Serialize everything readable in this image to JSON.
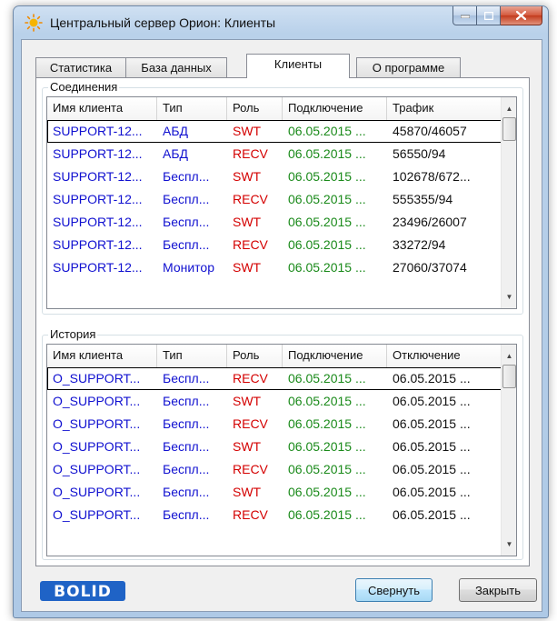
{
  "window": {
    "title": "Центральный сервер Орион: Клиенты"
  },
  "tabs": [
    {
      "label": "Статистика",
      "active": false
    },
    {
      "label": "База данных",
      "active": false
    },
    {
      "label": "Клиенты",
      "active": true
    },
    {
      "label": "О программе",
      "active": false
    }
  ],
  "connections": {
    "group_label": "Соединения",
    "columns": [
      "Имя клиента",
      "Тип",
      "Роль",
      "Подключение",
      "Трафик"
    ],
    "rows": [
      [
        "SUPPORT-12...",
        "АБД",
        "SWT",
        "06.05.2015 ...",
        "45870/46057"
      ],
      [
        "SUPPORT-12...",
        "АБД",
        "RECV",
        "06.05.2015 ...",
        "56550/94"
      ],
      [
        "SUPPORT-12...",
        "Беспл...",
        "SWT",
        "06.05.2015 ...",
        "102678/672..."
      ],
      [
        "SUPPORT-12...",
        "Беспл...",
        "RECV",
        "06.05.2015 ...",
        "555355/94"
      ],
      [
        "SUPPORT-12...",
        "Беспл...",
        "SWT",
        "06.05.2015 ...",
        "23496/26007"
      ],
      [
        "SUPPORT-12...",
        "Беспл...",
        "RECV",
        "06.05.2015 ...",
        "33272/94"
      ],
      [
        "SUPPORT-12...",
        "Монитор",
        "SWT",
        "06.05.2015 ...",
        "27060/37074"
      ]
    ]
  },
  "history": {
    "group_label": "История",
    "columns": [
      "Имя клиента",
      "Тип",
      "Роль",
      "Подключение",
      "Отключение"
    ],
    "rows": [
      [
        "O_SUPPORT...",
        "Беспл...",
        "RECV",
        "06.05.2015 ...",
        "06.05.2015 ..."
      ],
      [
        "O_SUPPORT...",
        "Беспл...",
        "SWT",
        "06.05.2015 ...",
        "06.05.2015 ..."
      ],
      [
        "O_SUPPORT...",
        "Беспл...",
        "RECV",
        "06.05.2015 ...",
        "06.05.2015 ..."
      ],
      [
        "O_SUPPORT...",
        "Беспл...",
        "SWT",
        "06.05.2015 ...",
        "06.05.2015 ..."
      ],
      [
        "O_SUPPORT...",
        "Беспл...",
        "RECV",
        "06.05.2015 ...",
        "06.05.2015 ..."
      ],
      [
        "O_SUPPORT...",
        "Беспл...",
        "SWT",
        "06.05.2015 ...",
        "06.05.2015 ..."
      ],
      [
        "O_SUPPORT...",
        "Беспл...",
        "RECV",
        "06.05.2015 ...",
        "06.05.2015 ..."
      ]
    ]
  },
  "footer": {
    "logo_text": "BOLID",
    "collapse_label": "Свернуть",
    "close_label": "Закрыть"
  },
  "colors": {
    "name": "#1010d0",
    "role_swt": "#d40000",
    "role_recv": "#d40000",
    "date": "#1a8a1a",
    "logo": "#1f63c6"
  }
}
